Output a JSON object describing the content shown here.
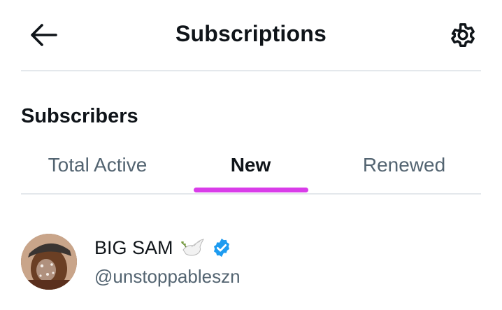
{
  "header": {
    "title": "Subscriptions",
    "back_icon": "arrow-left-icon",
    "settings_icon": "gear-icon"
  },
  "section": {
    "title": "Subscribers"
  },
  "tabs": [
    {
      "label": "Total Active",
      "active": false
    },
    {
      "label": "New",
      "active": true
    },
    {
      "label": "Renewed",
      "active": false
    }
  ],
  "colors": {
    "accent": "#d93ce9",
    "verified": "#1d9bf0",
    "text_primary": "#0f1419",
    "text_secondary": "#536471",
    "divider": "#e4e8ec"
  },
  "users": [
    {
      "name": "BIG SAM",
      "handle": "@unstoppableszn",
      "emoji_icon": "dove-icon",
      "verified": true
    }
  ]
}
